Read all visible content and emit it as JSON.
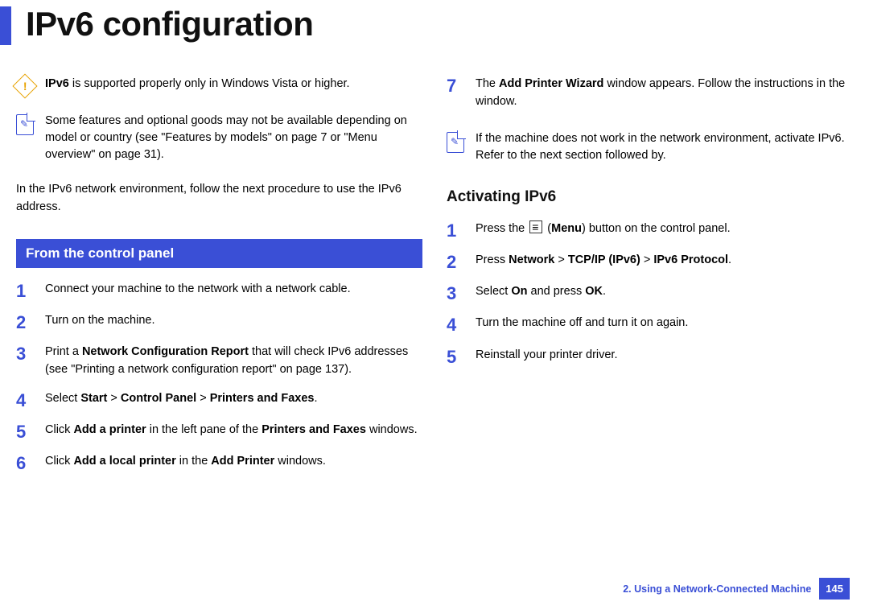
{
  "title": "IPv6 configuration",
  "left": {
    "warning": {
      "prefix": "IPv6",
      "text": " is supported properly only in Windows Vista or higher."
    },
    "note": "Some features and optional goods may not be available depending on model or country (see \"Features by models\" on page 7 or \"Menu overview\" on page 31).",
    "intro": "In the IPv6 network environment, follow the next procedure to use the IPv6 address.",
    "section": "From the control panel",
    "steps": [
      {
        "n": "1",
        "html": "Connect your machine to the network with a network cable."
      },
      {
        "n": "2",
        "html": "Turn on the machine."
      },
      {
        "n": "3",
        "html": "Print a <span class='b'>Network Configuration Report</span> that will check IPv6 addresses (see \"Printing a network configuration report\" on page 137)."
      },
      {
        "n": "4",
        "html": "Select <span class='b'>Start</span> > <span class='b'>Control Panel</span> > <span class='b'>Printers and Faxes</span>."
      },
      {
        "n": "5",
        "html": "Click <span class='b'>Add a printer</span> in the left pane of the <span class='b'>Printers and Faxes</span> windows."
      },
      {
        "n": "6",
        "html": "Click <span class='b'>Add a local printer</span> in the <span class='b'>Add Printer</span> windows."
      }
    ]
  },
  "right": {
    "step7": {
      "n": "7",
      "html": "The <span class='b'>Add Printer Wizard</span> window appears. Follow the instructions in the window."
    },
    "note": "If the machine does not work in the network environment, activate IPv6. Refer to the next section followed by.",
    "sub": "Activating IPv6",
    "steps": [
      {
        "n": "1",
        "html": "Press the <span class='menu-icon' data-name='menu-icon' data-interactable='false'></span> (<span class='b'>Menu</span>) button on the control panel."
      },
      {
        "n": "2",
        "html": "Press <span class='b'>Network</span> > <span class='b'>TCP/IP (IPv6)</span> > <span class='b'>IPv6 Protocol</span>."
      },
      {
        "n": "3",
        "html": "Select <span class='b'>On</span> and press <span class='b'>OK</span>."
      },
      {
        "n": "4",
        "html": "Turn the machine off and turn it on again."
      },
      {
        "n": "5",
        "html": "Reinstall your printer driver."
      }
    ]
  },
  "footer": {
    "chapter": "2.  Using a Network-Connected Machine",
    "page": "145"
  }
}
